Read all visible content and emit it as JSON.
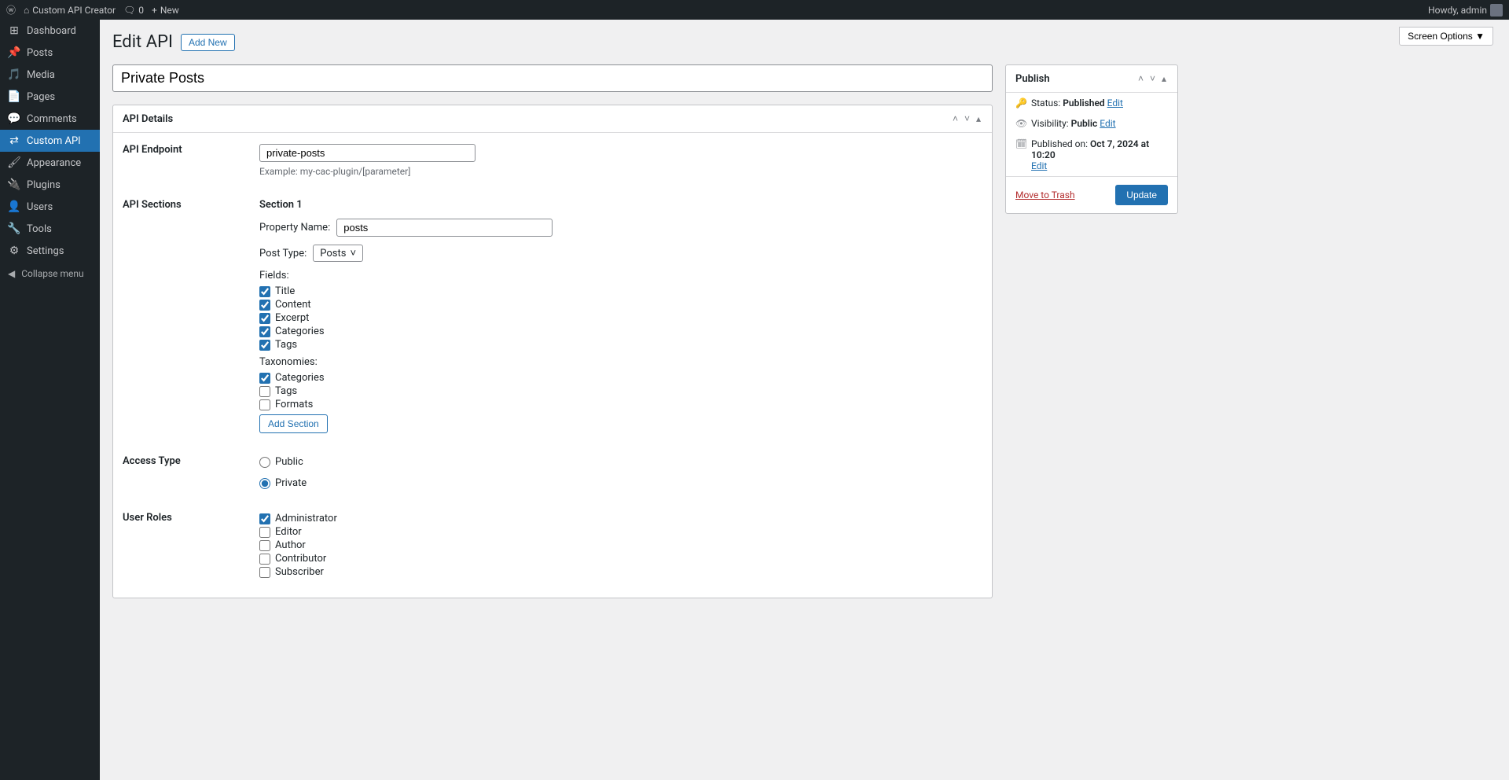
{
  "adminbar": {
    "site_name": "Custom API Creator",
    "comments_count": "0",
    "new_label": "New",
    "howdy": "Howdy, admin"
  },
  "sidebar": {
    "items": [
      {
        "label": "Dashboard",
        "icon": "dashboard"
      },
      {
        "label": "Posts",
        "icon": "pin"
      },
      {
        "label": "Media",
        "icon": "media"
      },
      {
        "label": "Pages",
        "icon": "page"
      },
      {
        "label": "Comments",
        "icon": "comment"
      },
      {
        "label": "Custom API",
        "icon": "api",
        "active": true
      },
      {
        "label": "Appearance",
        "icon": "brush"
      },
      {
        "label": "Plugins",
        "icon": "plug"
      },
      {
        "label": "Users",
        "icon": "user"
      },
      {
        "label": "Tools",
        "icon": "tool"
      },
      {
        "label": "Settings",
        "icon": "settings"
      }
    ],
    "collapse_label": "Collapse menu"
  },
  "page": {
    "heading": "Edit API",
    "add_new": "Add New",
    "screen_options": "Screen Options",
    "title_value": "Private Posts"
  },
  "api_details": {
    "box_title": "API Details",
    "endpoint_label": "API Endpoint",
    "endpoint_value": "private-posts",
    "endpoint_hint": "Example: my-cac-plugin/[parameter]",
    "sections_label": "API Sections",
    "section_heading": "Section 1",
    "property_name_label": "Property Name:",
    "property_name_value": "posts",
    "post_type_label": "Post Type:",
    "post_type_value": "Posts",
    "fields_label": "Fields:",
    "fields": [
      {
        "label": "Title",
        "checked": true
      },
      {
        "label": "Content",
        "checked": true
      },
      {
        "label": "Excerpt",
        "checked": true
      },
      {
        "label": "Categories",
        "checked": true
      },
      {
        "label": "Tags",
        "checked": true
      }
    ],
    "taxonomies_label": "Taxonomies:",
    "taxonomies": [
      {
        "label": "Categories",
        "checked": true
      },
      {
        "label": "Tags",
        "checked": false
      },
      {
        "label": "Formats",
        "checked": false
      }
    ],
    "add_section_btn": "Add Section",
    "access_type_label": "Access Type",
    "access_public": "Public",
    "access_private": "Private",
    "access_selected": "private",
    "user_roles_label": "User Roles",
    "user_roles": [
      {
        "label": "Administrator",
        "checked": true
      },
      {
        "label": "Editor",
        "checked": false
      },
      {
        "label": "Author",
        "checked": false
      },
      {
        "label": "Contributor",
        "checked": false
      },
      {
        "label": "Subscriber",
        "checked": false
      }
    ]
  },
  "publish": {
    "box_title": "Publish",
    "status_label": "Status:",
    "status_value": "Published",
    "status_edit": "Edit",
    "visibility_label": "Visibility:",
    "visibility_value": "Public",
    "visibility_edit": "Edit",
    "published_on_label": "Published on:",
    "published_on_value": "Oct 7, 2024 at 10:20",
    "published_edit": "Edit",
    "trash_label": "Move to Trash",
    "update_btn": "Update"
  }
}
